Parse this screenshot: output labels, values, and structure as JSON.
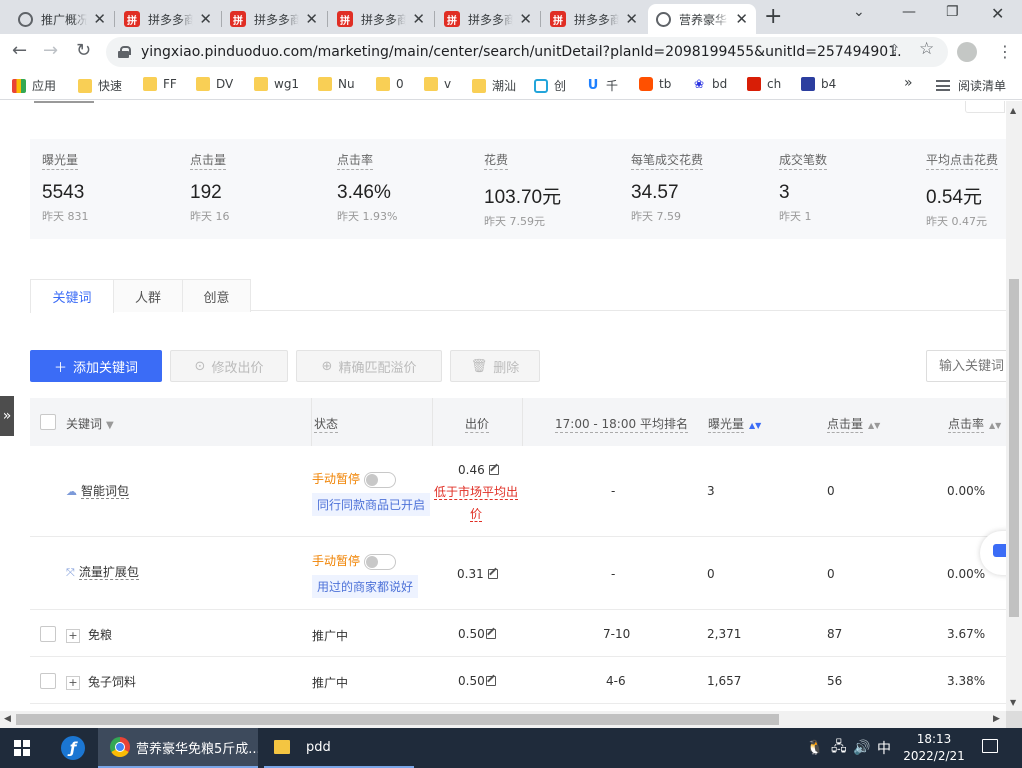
{
  "browser": {
    "tabs": [
      {
        "title": "推广概况",
        "icon": "globe-icon",
        "active": false
      },
      {
        "title": "拼多多商家后台",
        "icon": "pinduoduo-icon",
        "active": false
      },
      {
        "title": "拼多多商家后台",
        "icon": "pinduoduo-icon",
        "active": false
      },
      {
        "title": "拼多多商家后台",
        "icon": "pinduoduo-icon",
        "active": false
      },
      {
        "title": "拼多多商家后台",
        "icon": "pinduoduo-icon",
        "active": false
      },
      {
        "title": "拼多多商家后台",
        "icon": "pinduoduo-icon",
        "active": false
      },
      {
        "title": "营养豪华",
        "icon": "globe-icon",
        "active": true
      }
    ],
    "new_tab": "+",
    "url": "yingxiao.pinduoduo.com/marketing/main/center/search/unitDetail?planId=2098199455&unitId=257494901...",
    "bookmarks": [
      {
        "label": "应用",
        "icon": "apps-icon"
      },
      {
        "label": "快速",
        "icon": "folder-icon"
      },
      {
        "label": "FF",
        "icon": "folder-icon"
      },
      {
        "label": "DV",
        "icon": "folder-icon"
      },
      {
        "label": "wg1",
        "icon": "folder-icon"
      },
      {
        "label": "Nu",
        "icon": "folder-icon"
      },
      {
        "label": "0",
        "icon": "folder-icon"
      },
      {
        "label": "v",
        "icon": "folder-icon"
      },
      {
        "label": "潮汕",
        "icon": "folder-icon"
      },
      {
        "label": "创",
        "icon": "bilibili-icon"
      },
      {
        "label": "千",
        "icon": "u-icon"
      },
      {
        "label": "tb",
        "icon": "taobao-icon"
      },
      {
        "label": "bd",
        "icon": "baidu-icon"
      },
      {
        "label": "ch",
        "icon": "zhong-icon"
      },
      {
        "label": "b4",
        "icon": "bag-icon"
      }
    ],
    "bookmarks_more": "»",
    "reading_list": "阅读清单"
  },
  "metrics": [
    {
      "label": "曝光量",
      "value": "5543",
      "prev": "昨天 831"
    },
    {
      "label": "点击量",
      "value": "192",
      "prev": "昨天 16"
    },
    {
      "label": "点击率",
      "value": "3.46%",
      "prev": "昨天 1.93%"
    },
    {
      "label": "花费",
      "value": "103.70元",
      "prev": "昨天 7.59元"
    },
    {
      "label": "每笔成交花费",
      "value": "34.57",
      "prev": "昨天 7.59"
    },
    {
      "label": "成交笔数",
      "value": "3",
      "prev": "昨天 1"
    },
    {
      "label": "平均点击花费",
      "value": "0.54元",
      "prev": "昨天 0.47元"
    }
  ],
  "subtabs": [
    {
      "label": "关键词",
      "active": true
    },
    {
      "label": "人群",
      "active": false
    },
    {
      "label": "创意",
      "active": false
    }
  ],
  "actions": {
    "add_keyword": "添加关键词",
    "modify_bid": "修改出价",
    "exact_premium": "精确匹配溢价",
    "delete": "删除",
    "search_placeholder": "输入关键词"
  },
  "table": {
    "headers": {
      "keyword": "关键词",
      "status": "状态",
      "bid": "出价",
      "rank": "17:00 - 18:00 平均排名",
      "impressions": "曝光量",
      "clicks": "点击量",
      "ctr": "点击率"
    },
    "packages": [
      {
        "name": "智能词包",
        "icon": "cloud-icon",
        "status": "手动暂停",
        "note": "同行同款商品已开启",
        "bid": "0.46",
        "bid_warning": "低于市场平均出价",
        "rank": "-",
        "impressions": "3",
        "clicks": "0",
        "ctr": "0.00%"
      },
      {
        "name": "流量扩展包",
        "icon": "expand-arrows-icon",
        "status": "手动暂停",
        "note": "用过的商家都说好",
        "bid": "0.31",
        "rank": "-",
        "impressions": "0",
        "clicks": "0",
        "ctr": "0.00%"
      }
    ],
    "rows": [
      {
        "keyword": "免粮",
        "status": "推广中",
        "bid": "0.50",
        "rank": "7-10",
        "impressions": "2,371",
        "clicks": "87",
        "ctr": "3.67%"
      },
      {
        "keyword": "兔子饲料",
        "status": "推广中",
        "bid": "0.50",
        "rank": "4-6",
        "impressions": "1,657",
        "clicks": "56",
        "ctr": "3.38%"
      }
    ]
  },
  "side_handle": "»",
  "taskbar": {
    "chrome_title": "营养豪华免粮5斤成...",
    "folder_title": "pdd",
    "ime": "中",
    "time": "18:13",
    "date": "2022/2/21"
  }
}
